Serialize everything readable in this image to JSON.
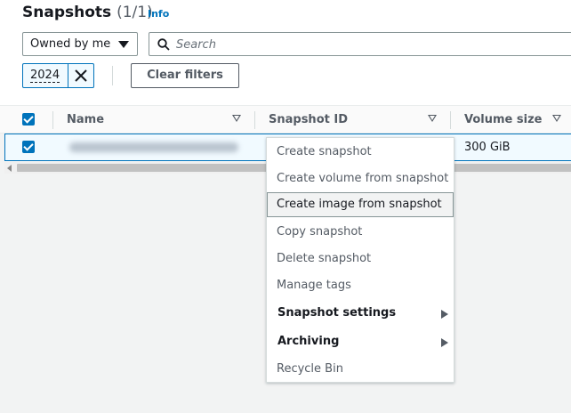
{
  "header": {
    "title": "Snapshots",
    "count": "(1/1)",
    "info_link": "Info"
  },
  "filters": {
    "owner_select": "Owned by me",
    "search_placeholder": "Search",
    "token_value": "2024",
    "clear_label": "Clear filters"
  },
  "table": {
    "columns": [
      "Name",
      "Snapshot ID",
      "Volume size"
    ],
    "rows": [
      {
        "volume_size": "300 GiB",
        "selected": true
      }
    ]
  },
  "context_menu": {
    "items": [
      {
        "label": "Create snapshot",
        "state": "default"
      },
      {
        "label": "Create volume from snapshot",
        "state": "default"
      },
      {
        "label": "Create image from snapshot",
        "state": "hovered"
      },
      {
        "label": "Copy snapshot",
        "state": "default"
      },
      {
        "label": "Delete snapshot",
        "state": "default"
      },
      {
        "label": "Manage tags",
        "state": "default"
      },
      {
        "label": "Snapshot settings",
        "state": "submenu"
      },
      {
        "label": "Archiving",
        "state": "submenu"
      },
      {
        "label": "Recycle Bin",
        "state": "default"
      }
    ]
  },
  "colors": {
    "accent": "#0073bb",
    "text": "#16191f",
    "muted": "#545b64",
    "background": "#f2f3f3"
  }
}
